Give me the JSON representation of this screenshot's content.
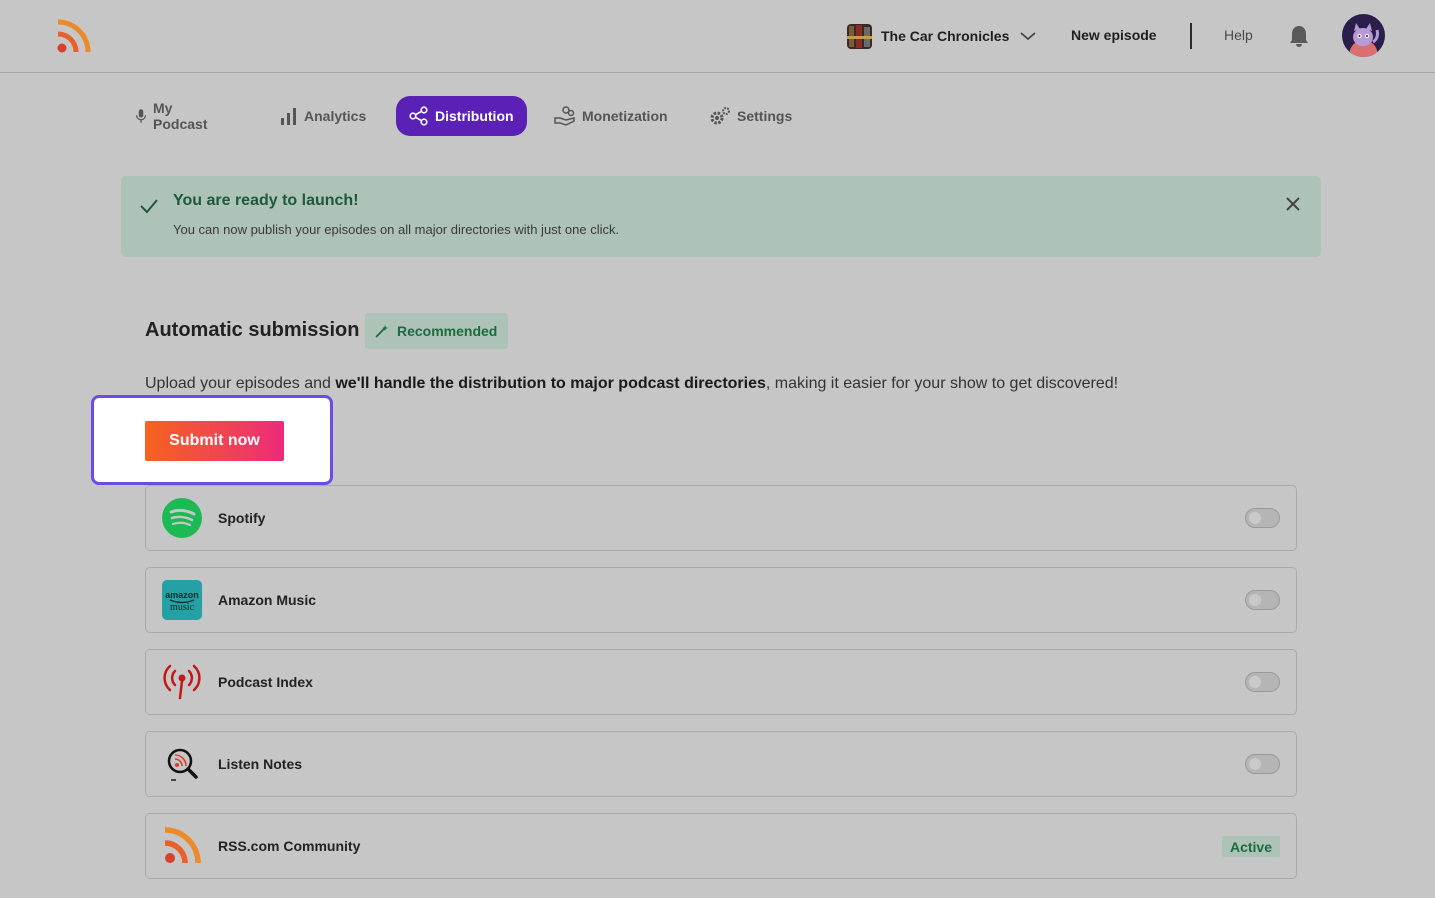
{
  "header": {
    "logo_icon": "rss-logo-icon",
    "show_title": "The Car Chronicles",
    "new_episode_label": "New episode",
    "help_label": "Help",
    "bell_icon": "bell-icon",
    "avatar_icon": "user-avatar"
  },
  "tabs": [
    {
      "label": "My Podcast",
      "icon": "microphone-icon"
    },
    {
      "label": "Analytics",
      "icon": "bar-chart-icon"
    },
    {
      "label": "Distribution",
      "icon": "share-icon",
      "active": true
    },
    {
      "label": "Monetization",
      "icon": "hand-coins-icon"
    },
    {
      "label": "Settings",
      "icon": "gears-icon"
    }
  ],
  "banner": {
    "title": "You are ready to launch!",
    "text": "You can now publish your episodes on all major directories with just one click."
  },
  "auto_submission": {
    "title": "Automatic submission",
    "badge": "Recommended",
    "desc_before": "Upload your episodes and ",
    "desc_bold": "we'll handle the distribution to major podcast directories",
    "desc_after": ", making it easier for your show to get discovered!",
    "submit_label": "Submit now"
  },
  "directories": [
    {
      "name": "Spotify",
      "icon": "spotify-icon",
      "state": "off"
    },
    {
      "name": "Amazon Music",
      "icon": "amazon-music-icon",
      "icon_text_top": "amazon",
      "icon_text_bottom": "music",
      "state": "off"
    },
    {
      "name": "Podcast Index",
      "icon": "podcast-index-icon",
      "state": "off"
    },
    {
      "name": "Listen Notes",
      "icon": "listen-notes-icon",
      "state": "off"
    },
    {
      "name": "RSS.com Community",
      "icon": "rss-community-icon",
      "state": "active",
      "status_label": "Active"
    }
  ],
  "colors": {
    "primary": "#5b21b6",
    "highlight_border": "#6b4ce6",
    "success_bg": "#adc3b8",
    "success_text": "#1d5a3a",
    "cta_start": "#f6621e",
    "cta_end": "#ec2a79"
  }
}
